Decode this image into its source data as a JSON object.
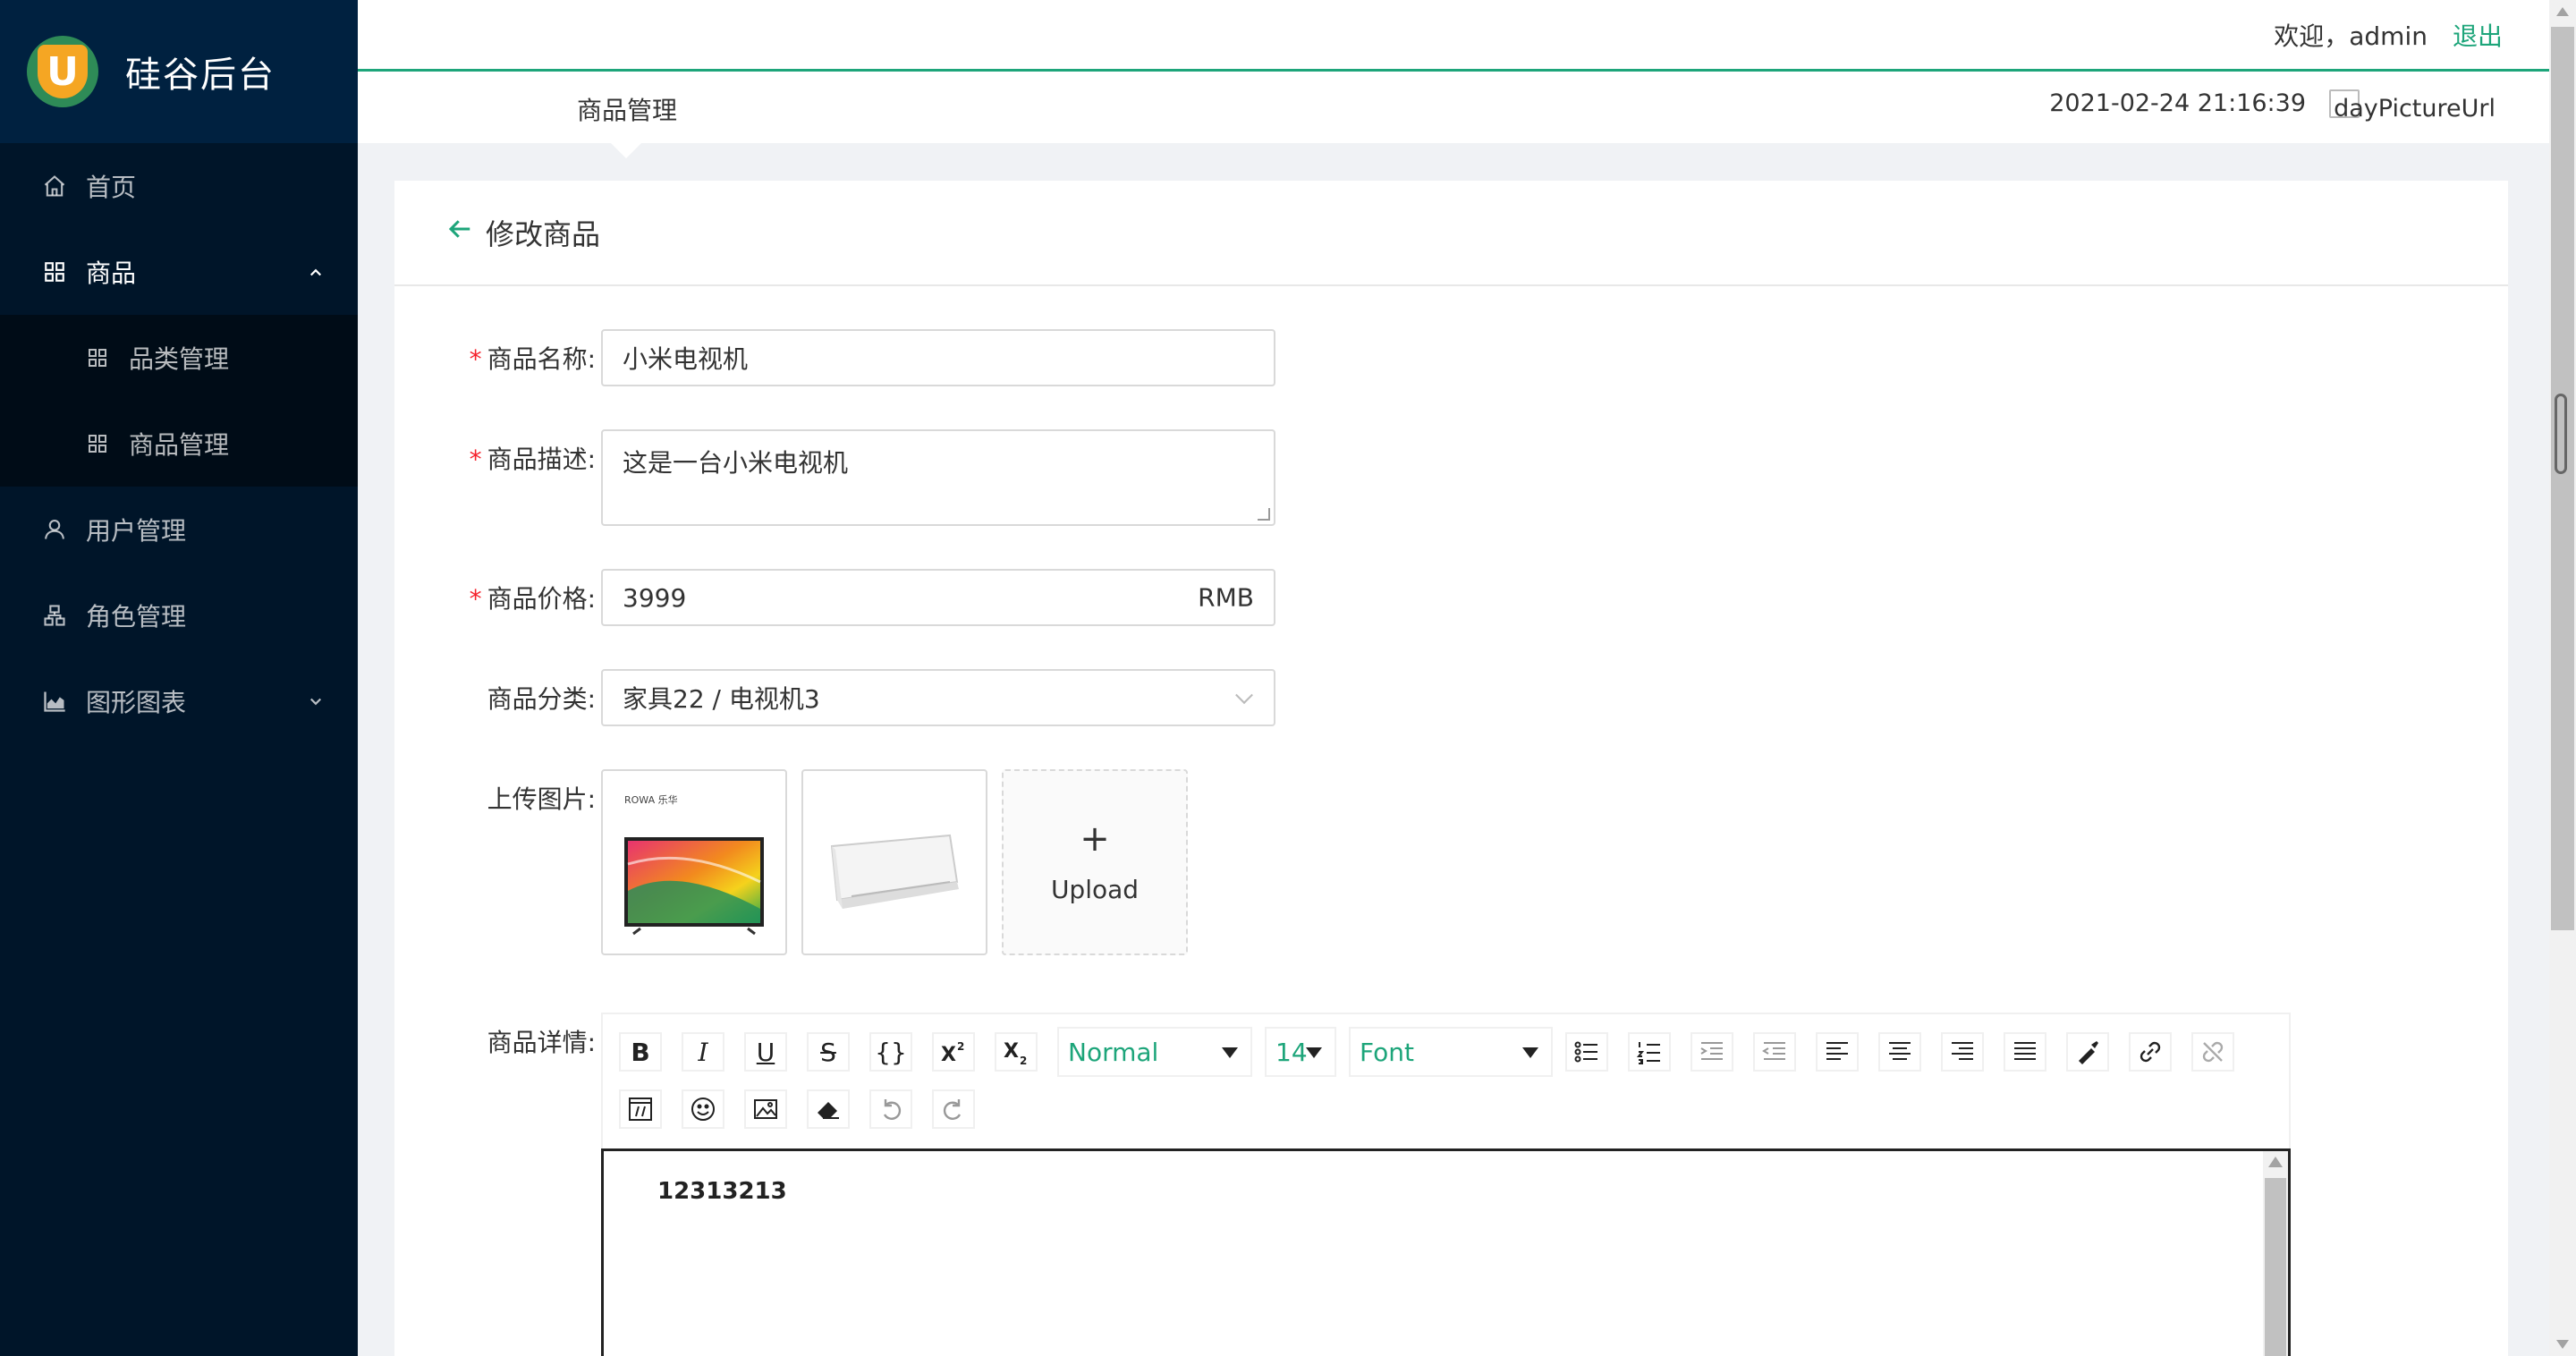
{
  "brand": {
    "title": "硅谷后台",
    "logo_letter": "U"
  },
  "sidebar": {
    "items": [
      {
        "label": "首页",
        "icon": "home-icon"
      },
      {
        "label": "商品",
        "icon": "appstore-icon",
        "expanded": true,
        "children": [
          {
            "label": "品类管理",
            "icon": "appstore-icon"
          },
          {
            "label": "商品管理",
            "icon": "appstore-icon"
          }
        ]
      },
      {
        "label": "用户管理",
        "icon": "user-icon"
      },
      {
        "label": "角色管理",
        "icon": "safety-icon"
      },
      {
        "label": "图形图表",
        "icon": "area-chart-icon"
      }
    ]
  },
  "header": {
    "welcome": "欢迎，admin",
    "logout": "退出",
    "breadcrumb": "商品管理",
    "datetime": "2021-02-24 21:16:39",
    "weather_alt": "dayPictureUrl"
  },
  "card": {
    "back_icon": "arrow-left-icon",
    "title": "修改商品"
  },
  "form": {
    "name": {
      "label": "商品名称:",
      "value": "小米电视机",
      "required": true
    },
    "desc": {
      "label": "商品描述:",
      "value": "这是一台小米电视机",
      "required": true
    },
    "price": {
      "label": "商品价格:",
      "value": "3999",
      "suffix": "RMB",
      "required": true
    },
    "category": {
      "label": "商品分类:",
      "value": "家具22 / 电视机3"
    },
    "images": {
      "label": "上传图片:",
      "upload_label": "Upload",
      "plus": "+",
      "tv_brand": "ROWA 乐华"
    },
    "detail": {
      "label": "商品详情:"
    }
  },
  "editor": {
    "block_format": "Normal",
    "font_size": "14",
    "font_family": "Font",
    "content": "12313213",
    "buttons": [
      "B",
      "I",
      "U",
      "S",
      "{}"
    ]
  },
  "colors": {
    "accent": "#1da57a",
    "sidebar_bg": "#001529",
    "sidebar_sub_bg": "#000c17",
    "required": "#f5222d"
  }
}
